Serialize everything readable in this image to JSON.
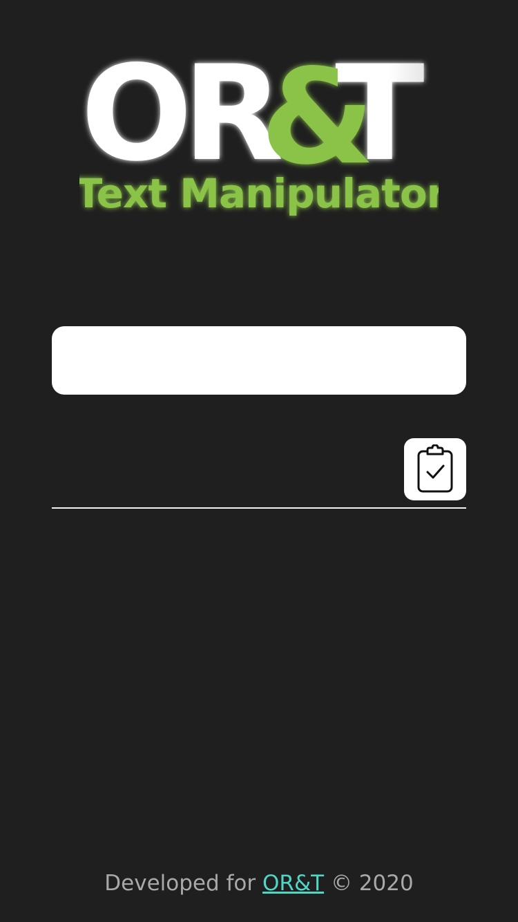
{
  "logo": {
    "word_or": "OR",
    "word_amp": "&",
    "word_t": "T",
    "subtitle": "Text Manipulator",
    "colors": {
      "white": "#ffffff",
      "green": "#8bc34a"
    }
  },
  "input": {
    "value": "",
    "placeholder": ""
  },
  "output": {
    "value": "",
    "copy_icon": "clipboard-check-icon"
  },
  "footer": {
    "prefix": "Developed for",
    "link_text": "OR&T",
    "suffix": "© 2020",
    "link_color": "#4fd6c4"
  },
  "theme": {
    "background": "#1f1f1f",
    "foreground": "#ffffff"
  }
}
